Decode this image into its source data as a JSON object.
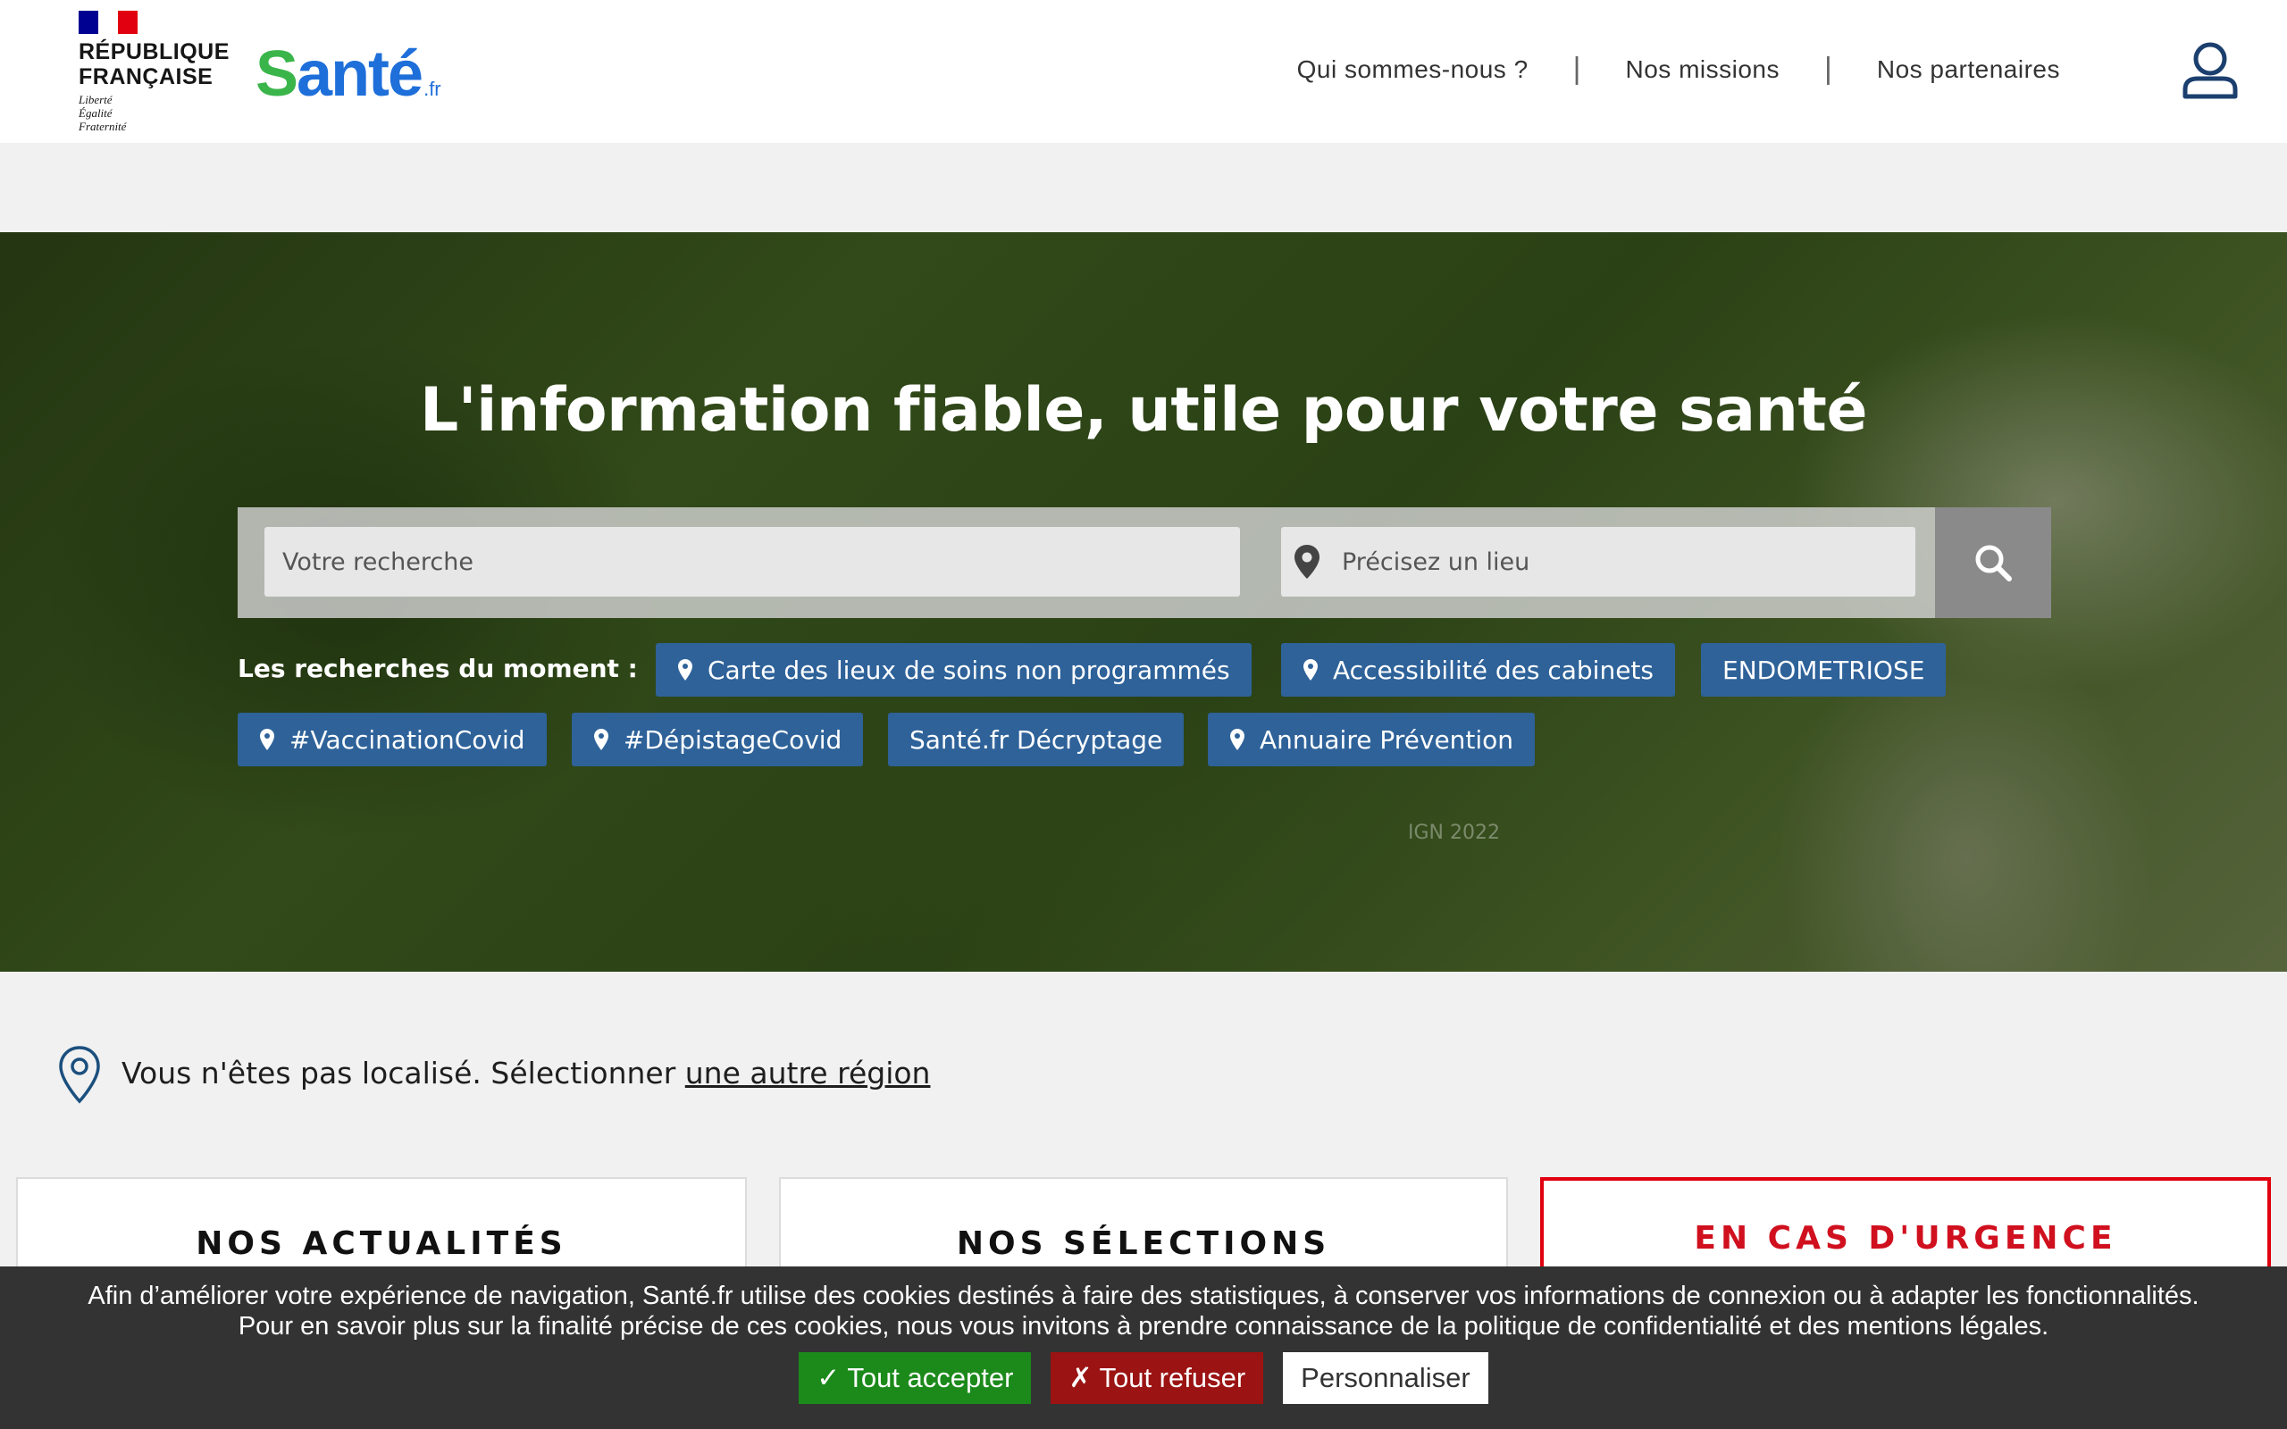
{
  "header": {
    "rf_name_line1": "RÉPUBLIQUE",
    "rf_name_line2": "FRANÇAISE",
    "rf_motto_1": "Liberté",
    "rf_motto_2": "Égalité",
    "rf_motto_3": "Fraternité",
    "logo_main_s": "S",
    "logo_main_rest": "anté",
    "logo_suffix": ".fr",
    "nav": [
      "Qui sommes-nous ?",
      "Nos missions",
      "Nos partenaires"
    ],
    "nav_separator": "|"
  },
  "hero": {
    "title": "L'information fiable, utile pour votre santé",
    "search_placeholder": "Votre recherche",
    "place_placeholder": "Précisez un lieu",
    "tags_label": "Les recherches du moment :",
    "tags": [
      {
        "label": "Carte des lieux de soins non programmés",
        "icon": "map-pin-icon"
      },
      {
        "label": "Accessibilité des cabinets",
        "icon": "map-pin-icon"
      },
      {
        "label": "ENDOMETRIOSE",
        "icon": ""
      },
      {
        "label": "#VaccinationCovid",
        "icon": "map-pin-icon"
      },
      {
        "label": "#DépistageCovid",
        "icon": "map-pin-icon"
      },
      {
        "label": "Santé.fr Décryptage",
        "icon": ""
      },
      {
        "label": "Annuaire Prévention",
        "icon": "map-pin-icon"
      }
    ],
    "image_credit": "IGN 2022"
  },
  "location": {
    "text": "Vous n'êtes pas localisé.  Sélectionner ",
    "link": "une autre région"
  },
  "cards": [
    "NOS ACTUALITÉS",
    "NOS SÉLECTIONS",
    "EN CAS D'URGENCE"
  ],
  "cookie": {
    "line1": "Afin d’améliorer votre expérience de navigation, Santé.fr utilise des cookies destinés à faire des statistiques, à conserver vos informations de connexion ou à adapter les fonctionnalités.",
    "line2": "Pour en savoir plus sur la finalité précise de ces cookies, nous vous invitons à prendre connaissance de la politique de confidentialité et des mentions légales.",
    "accept": "✓ Tout accepter",
    "deny": "✗ Tout refuser",
    "custom": "Personnaliser"
  },
  "colors": {
    "tag_bg": "#2e6299",
    "urgent_red": "#e1000f",
    "logo_blue": "#1e6fd9",
    "logo_green": "#3ab54a"
  }
}
